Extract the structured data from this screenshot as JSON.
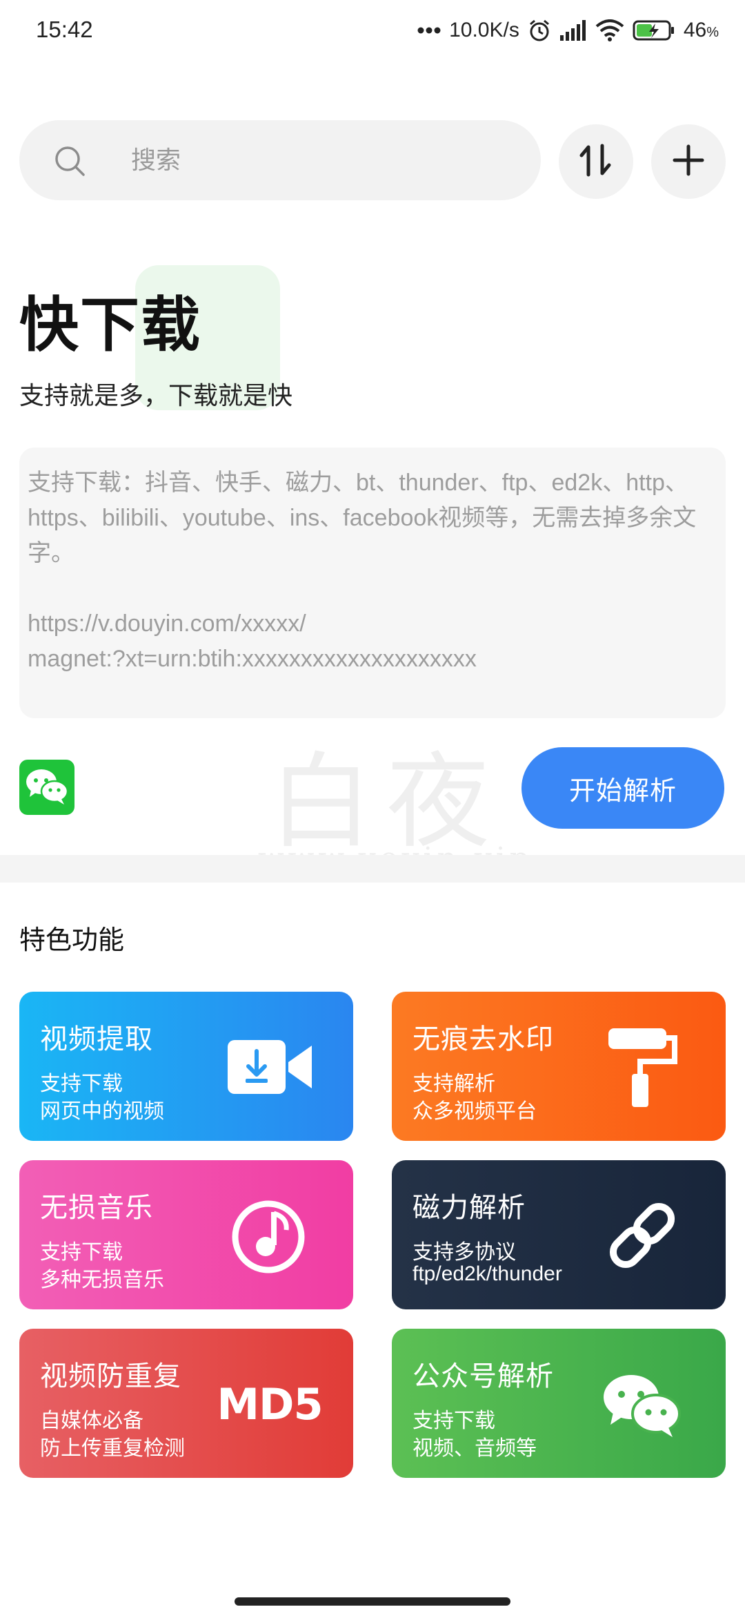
{
  "status_bar": {
    "time": "15:42",
    "net_speed": "10.0K/s",
    "battery": "46",
    "battery_unit": "%",
    "icons": [
      "more-dots-icon",
      "alarm-icon",
      "signal-icon",
      "wifi-icon",
      "battery-charging-icon"
    ]
  },
  "search": {
    "placeholder": "搜索",
    "icon": "search-icon"
  },
  "toolbar": {
    "sort_icon": "sort-updown-icon",
    "add_icon": "plus-icon"
  },
  "hero": {
    "title": "快下载",
    "subtitle": "支持就是多，下载就是快"
  },
  "url_input": {
    "hint": "支持下载：抖音、快手、磁力、bt、thunder、ftp、ed2k、http、https、bilibili、youtube、ins、facebook视频等，无需去掉多余文字。",
    "example_1": "https://v.douyin.com/xxxxx/",
    "example_2": "magnet:?xt=urn:btih:xxxxxxxxxxxxxxxxxxxx"
  },
  "actions": {
    "wechat_icon": "wechat-icon",
    "parse_label": "开始解析",
    "accent": "#3a87f6"
  },
  "watermark": {
    "text": "白夜",
    "sub": "www.yeyin.vip"
  },
  "features": {
    "section_title": "特色功能",
    "items": [
      {
        "title": "视频提取",
        "desc1": "支持下载",
        "desc2": "网页中的视频",
        "icon": "video-download-icon",
        "color": "#1ab6f5"
      },
      {
        "title": "无痕去水印",
        "desc1": "支持解析",
        "desc2": "众多视频平台",
        "icon": "paint-roller-icon",
        "color": "#fb6a1a"
      },
      {
        "title": "无损音乐",
        "desc1": "支持下载",
        "desc2": "多种无损音乐",
        "icon": "music-note-icon",
        "color": "#f14aab"
      },
      {
        "title": "磁力解析",
        "desc1": "支持多协议",
        "desc2": "ftp/ed2k/thunder",
        "icon": "link-chain-icon",
        "color": "#1e2c40"
      },
      {
        "title": "视频防重复",
        "desc1": "自媒体必备",
        "desc2": "防上传重复检测",
        "icon": "md5-icon",
        "icon_text": "MD5",
        "color": "#e34a47"
      },
      {
        "title": "公众号解析",
        "desc1": "支持下载",
        "desc2": "视频、音频等",
        "icon": "wechat-icon",
        "color": "#48b24e"
      }
    ]
  }
}
